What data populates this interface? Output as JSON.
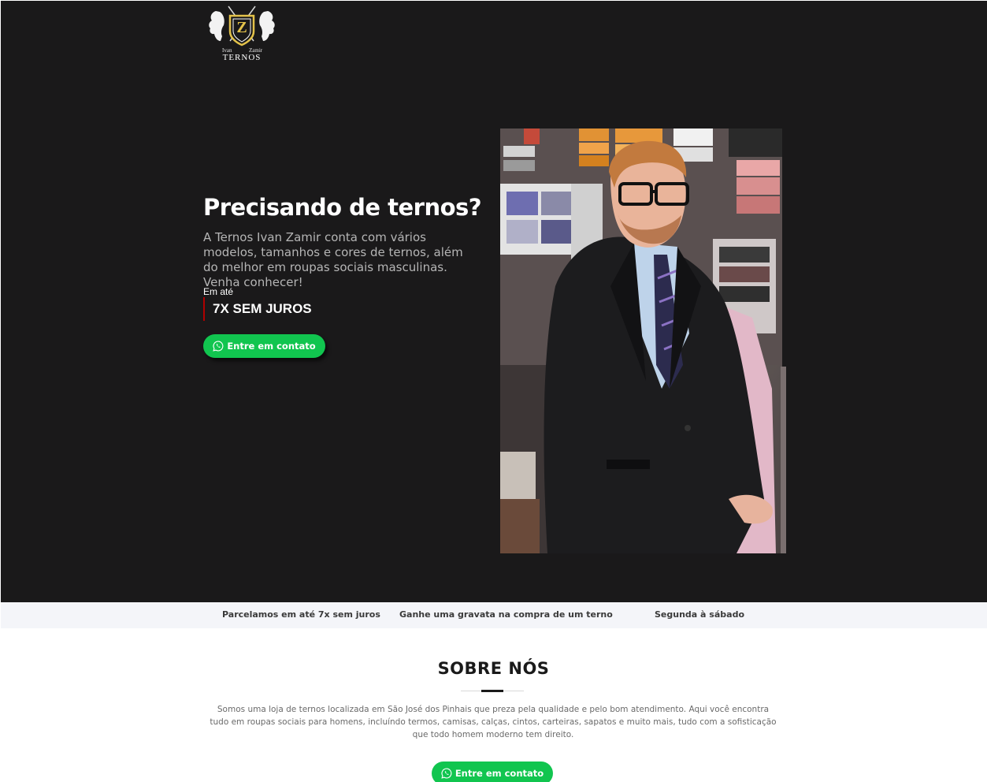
{
  "colors": {
    "hero_background": "#1a191a",
    "accent_green": "#11c54f",
    "accent_red": "#b00000",
    "features_background": "#f4f5f9"
  },
  "logo": {
    "letter": "Z",
    "small_left": "Ivan",
    "small_right": "Zamir",
    "word": "TERNOS"
  },
  "hero": {
    "title": "Precisando de ternos?",
    "description": "A Ternos Ivan Zamir conta com vários modelos, tamanhos e cores de ternos, além do melhor em roupas sociais masculinas. Venha conhecer!",
    "em_ate": "Em até",
    "juros": "7X SEM JUROS",
    "cta_label": "Entre em contato",
    "cta_icon": "whatsapp-icon"
  },
  "features": {
    "items": [
      "Parcelamos em até 7x sem juros",
      "Ganhe uma gravata na compra de um terno",
      "Segunda à sábado"
    ]
  },
  "about": {
    "title": "SOBRE NÓS",
    "text": "Somos uma loja de ternos localizada em São José dos Pinhais que preza pela qualidade e pelo bom atendimento. Aqui você encontra tudo em roupas sociais para homens, incluíndo termos, camisas, calças, cintos, carteiras, sapatos e muito mais, tudo com a sofisticação que todo homem moderno tem direito.",
    "cta_label": "Entre em contato",
    "cta_icon": "whatsapp-icon"
  }
}
